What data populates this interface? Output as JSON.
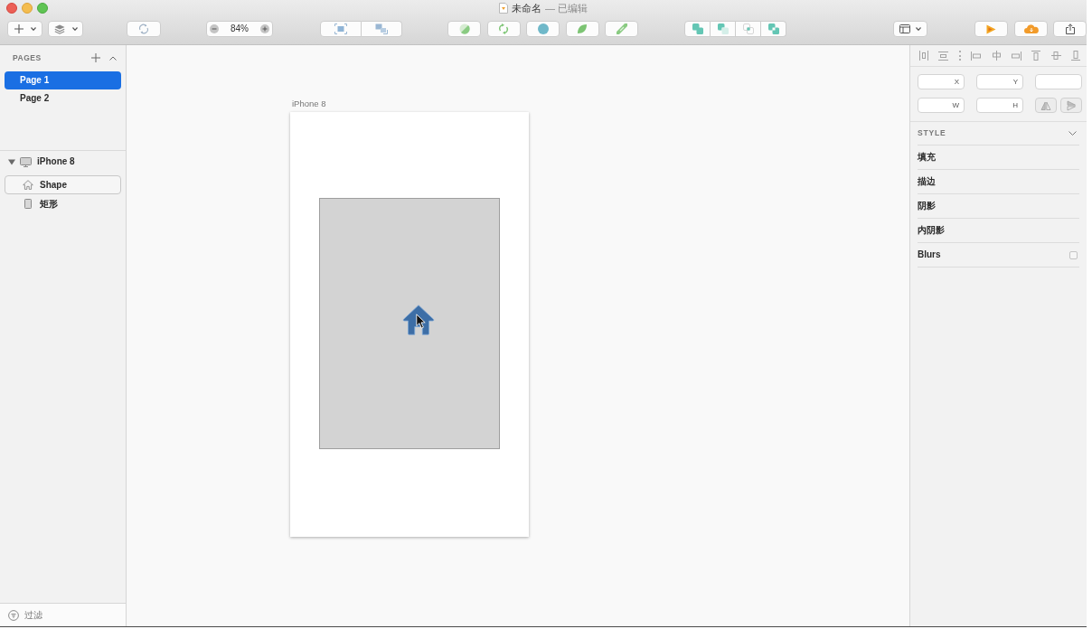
{
  "window": {
    "title": "未命名",
    "subtitle": "— 已编辑"
  },
  "toolbar": {
    "zoom": "84%"
  },
  "pages": {
    "header": "PAGES",
    "items": [
      {
        "label": "Page 1",
        "selected": true
      },
      {
        "label": "Page 2",
        "selected": false
      }
    ]
  },
  "layers": [
    {
      "label": "iPhone 8",
      "kind": "artboard",
      "expanded": true,
      "children": [
        {
          "label": "Shape",
          "kind": "shape",
          "hovered": true
        },
        {
          "label": "矩形",
          "kind": "rectangle",
          "hovered": false
        }
      ]
    }
  ],
  "filter": {
    "placeholder": "过滤"
  },
  "canvas": {
    "artboard": {
      "label": "iPhone 8"
    }
  },
  "inspector": {
    "fields": [
      {
        "kind": "field",
        "label": "X"
      },
      {
        "kind": "field",
        "label": "Y"
      },
      {
        "kind": "field"
      },
      {
        "kind": "field",
        "label": "W"
      },
      {
        "kind": "field",
        "label": "H"
      },
      {
        "kind": "flip"
      }
    ],
    "style": {
      "header": "STYLE",
      "expanded": true,
      "rows": [
        {
          "kind": "section",
          "label": "填充"
        },
        {
          "kind": "section",
          "label": "描边"
        },
        {
          "kind": "section",
          "label": "阴影"
        },
        {
          "kind": "section",
          "label": "内阴影"
        },
        {
          "kind": "toggle",
          "label": "Blurs",
          "checked": false
        }
      ]
    }
  }
}
